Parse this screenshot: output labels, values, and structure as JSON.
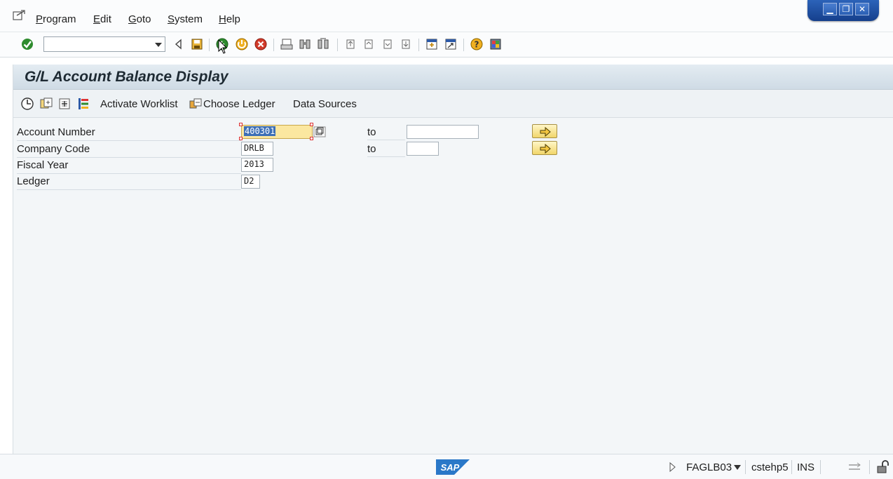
{
  "menu": {
    "items": [
      {
        "label": "Program",
        "underline": "P",
        "rest": "rogram"
      },
      {
        "label": "Edit",
        "underline": "E",
        "rest": "dit"
      },
      {
        "label": "Goto",
        "underline": "G",
        "rest": "oto"
      },
      {
        "label": "System",
        "underline": "S",
        "rest": "ystem"
      },
      {
        "label": "Help",
        "underline": "H",
        "rest": "elp"
      }
    ]
  },
  "window_controls": {
    "minimize": "▁",
    "restore": "❐",
    "close": "✕"
  },
  "toolbar": {
    "command_field_value": "",
    "icons": [
      "enter-icon",
      "back-nav-icon",
      "save-icon",
      "back-icon",
      "exit-icon",
      "cancel-icon",
      "print-icon",
      "find-icon",
      "find-next-icon",
      "first-page-icon",
      "previous-page-icon",
      "next-page-icon",
      "last-page-icon",
      "create-session-icon",
      "shortcut-icon",
      "help-icon",
      "layout-icon"
    ]
  },
  "screen": {
    "title": "G/L Account Balance Display"
  },
  "app_toolbar": {
    "activate_worklist_label": "Activate Worklist",
    "choose_ledger_label": "Choose Ledger",
    "data_sources_label": "Data Sources"
  },
  "form": {
    "account_number": {
      "label": "Account Number",
      "value": "400301",
      "to_label": "to",
      "to_value": ""
    },
    "company_code": {
      "label": "Company Code",
      "value": "DRLB",
      "to_label": "to",
      "to_value": ""
    },
    "fiscal_year": {
      "label": "Fiscal Year",
      "value": "2013"
    },
    "ledger": {
      "label": "Ledger",
      "value": "D2"
    }
  },
  "status": {
    "sap_logo": "SAP",
    "transaction": "FAGLB03",
    "server": "cstehp5",
    "mode": "INS"
  },
  "colors": {
    "focus_field": "#fbe7a0",
    "selection": "#3d6fb6",
    "title_bar": "#cfdbe5",
    "window_controls": "#153f8c"
  }
}
